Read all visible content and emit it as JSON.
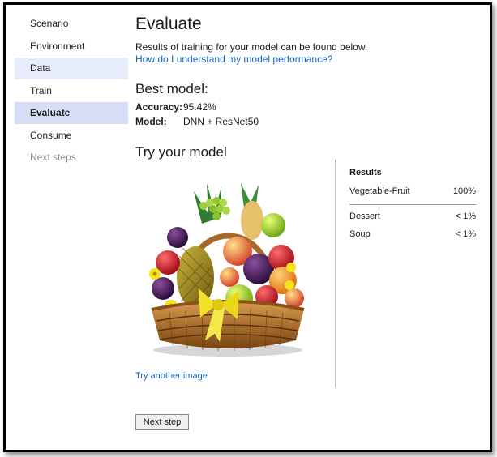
{
  "nav": {
    "items": [
      {
        "label": "Scenario",
        "state": "normal"
      },
      {
        "label": "Environment",
        "state": "normal"
      },
      {
        "label": "Data",
        "state": "light"
      },
      {
        "label": "Train",
        "state": "normal"
      },
      {
        "label": "Evaluate",
        "state": "active"
      },
      {
        "label": "Consume",
        "state": "normal"
      },
      {
        "label": "Next steps",
        "state": "disabled"
      }
    ]
  },
  "main": {
    "title": "Evaluate",
    "subtitle": "Results of training for your model can be found below.",
    "help_link": "How do I understand my model performance?",
    "best_model": {
      "heading": "Best model:",
      "accuracy_label": "Accuracy:",
      "accuracy_value": "95.42%",
      "model_label": "Model:",
      "model_value": "DNN + ResNet50"
    },
    "try": {
      "heading": "Try your model",
      "another_link": "Try another image"
    },
    "results": {
      "title": "Results",
      "rows": [
        {
          "label": "Vegetable-Fruit",
          "value": "100%"
        },
        {
          "label": "Dessert",
          "value": "< 1%"
        },
        {
          "label": "Soup",
          "value": "< 1%"
        }
      ]
    },
    "next_button": "Next step"
  }
}
